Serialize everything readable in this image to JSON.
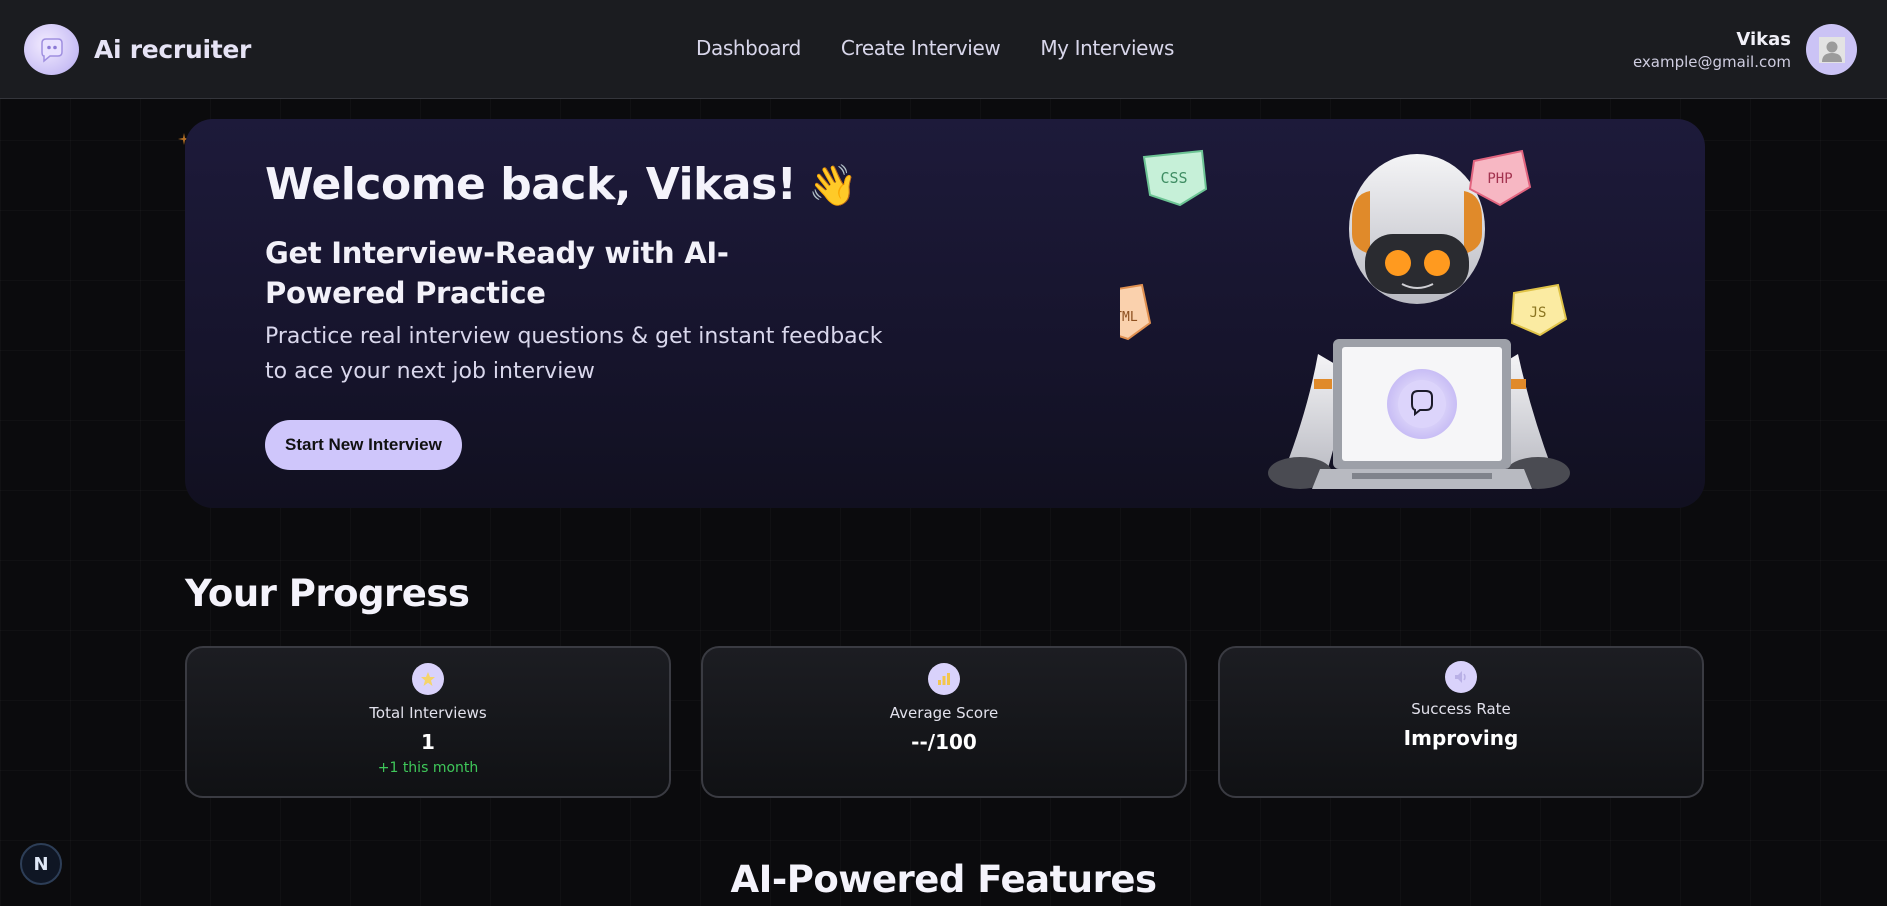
{
  "header": {
    "brand": "Ai recruiter",
    "nav": [
      "Dashboard",
      "Create Interview",
      "My Interviews"
    ],
    "user_name": "Vikas",
    "user_email": "example@gmail.com"
  },
  "hero": {
    "title": "Welcome back, Vikas!",
    "wave": "👋",
    "subtitle": "Get Interview-Ready with AI-Powered Practice",
    "description": "Practice real interview questions & get instant feedback to ace your next job interview",
    "cta": "Start New Interview",
    "badges": [
      "CSS",
      "PHP",
      "HTML",
      "JS"
    ]
  },
  "progress": {
    "title": "Your Progress",
    "cards": [
      {
        "label": "Total Interviews",
        "value": "1",
        "note": "+1 this month",
        "icon": "star-icon"
      },
      {
        "label": "Average Score",
        "value": "--/100",
        "note": "",
        "icon": "chart-icon"
      },
      {
        "label": "Success Rate",
        "value": "Improving",
        "note": "",
        "icon": "speaker-icon"
      }
    ]
  },
  "features": {
    "title": "AI-Powered Features"
  },
  "dev_badge": "N",
  "colors": {
    "accent": "#cfc6fb",
    "background": "#0b0b0d",
    "success": "#3fc85a"
  }
}
